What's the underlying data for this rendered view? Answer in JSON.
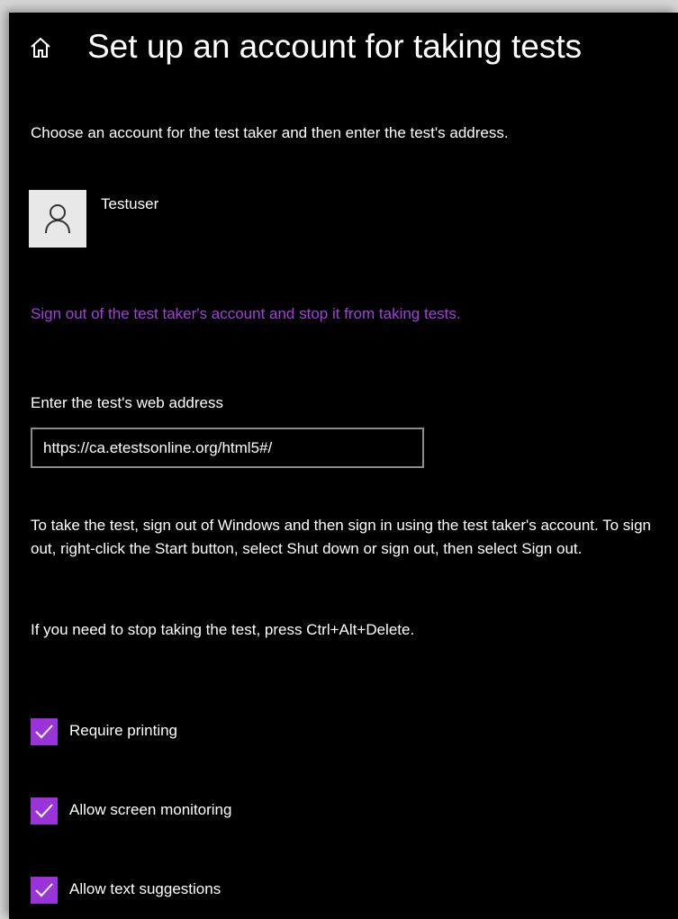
{
  "header": {
    "title": "Set up an account for taking tests",
    "home_icon": "home-icon"
  },
  "intro_text": "Choose an account for the test taker and then enter the test's address.",
  "account": {
    "name": "Testuser",
    "avatar_icon": "person-icon"
  },
  "signout_link": "Sign out of the test taker's account and stop it from taking tests.",
  "url_field": {
    "label": "Enter the test's web address",
    "value": "https://ca.etestsonline.org/html5#/"
  },
  "instructions": "To take the test, sign out of Windows and then sign in using the test taker's account. To sign out, right-click the Start button, select Shut down or sign out, then select Sign out.",
  "stop_note": "If you need to stop taking the test, press Ctrl+Alt+Delete.",
  "options": [
    {
      "label": "Require printing",
      "checked": true
    },
    {
      "label": "Allow screen monitoring",
      "checked": true
    },
    {
      "label": "Allow text suggestions",
      "checked": true
    }
  ],
  "colors": {
    "background": "#000000",
    "accent": "#9a33d8",
    "link": "#a53ee0",
    "text": "#ffffff"
  }
}
